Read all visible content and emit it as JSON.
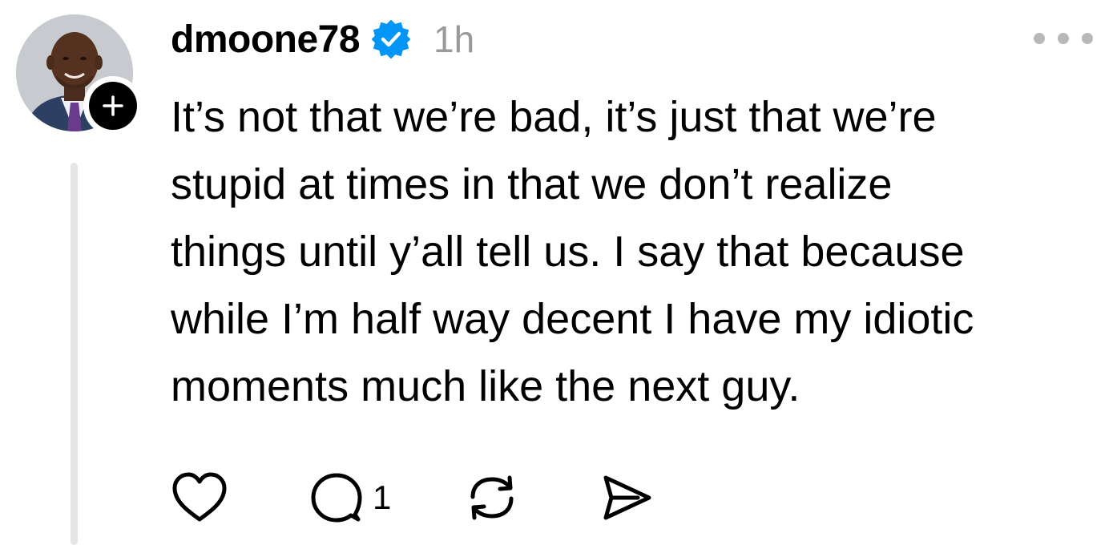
{
  "post": {
    "username": "dmoone78",
    "timestamp": "1h",
    "verified": true,
    "text": "It’s not that we’re bad, it’s just that we’re\nstupid at times in that we don’t realize\nthings until y’all tell us. I say that because\nwhile I’m half way decent I have my idiotic\nmoments much like the next guy.",
    "reply_count": "1"
  },
  "icons": {
    "verified": "verified-badge-icon",
    "follow": "plus-icon",
    "more": "more-icon",
    "like": "heart-icon",
    "reply": "comment-icon",
    "repost": "repost-icon",
    "share": "send-icon"
  },
  "colors": {
    "verified_blue": "#0095f6",
    "timestamp_gray": "#999999",
    "thread_line": "#e5e5e5",
    "icon_stroke": "#000000"
  }
}
